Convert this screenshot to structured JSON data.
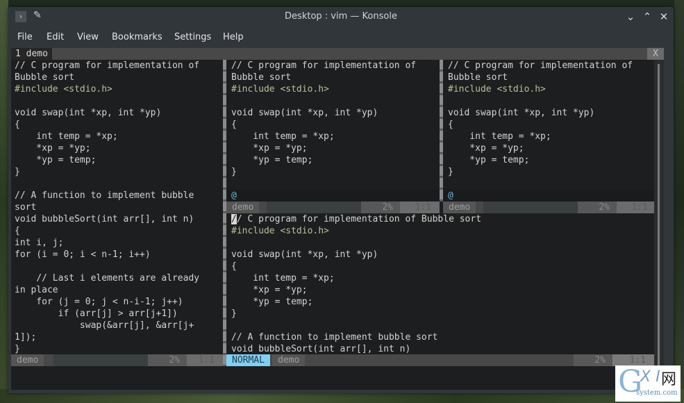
{
  "window": {
    "title": "Desktop : vim — Konsole",
    "app_icon": "terminal-icon",
    "controls": {
      "minimize": "⌄",
      "maximize": "⌃",
      "close": "✕"
    }
  },
  "menu": [
    "File",
    "Edit",
    "View",
    "Bookmarks",
    "Settings",
    "Help"
  ],
  "vim": {
    "tab": {
      "number": "1",
      "name": "demo",
      "close_label": "X"
    },
    "left_pane": {
      "lines": [
        "// C program for implementation of",
        "Bubble sort",
        "#include <stdio.h>",
        "",
        "void swap(int *xp, int *yp)",
        "{",
        "    int temp = *xp;",
        "    *xp = *yp;",
        "    *yp = temp;",
        "}",
        "",
        "// A function to implement bubble",
        "sort",
        "void bubbleSort(int arr[], int n)",
        "{",
        "int i, j;",
        "for (i = 0; i < n-1; i++)",
        "",
        "    // Last i elements are already",
        "in place",
        "    for (j = 0; j < n-i-1; j++)",
        "        if (arr[j] > arr[j+1])",
        "            swap(&arr[j], &arr[j+",
        "1]);",
        "}"
      ],
      "status": {
        "file": "demo",
        "percent": "2%",
        "position": "1:1"
      }
    },
    "top_middle_pane": {
      "lines": [
        "// C program for implementation of",
        "Bubble sort",
        "#include <stdio.h>",
        "",
        "void swap(int *xp, int *yp)",
        "{",
        "    int temp = *xp;",
        "    *xp = *yp;",
        "    *yp = temp;",
        "}",
        ""
      ],
      "filler": "@",
      "status": {
        "file": "demo",
        "percent": "2%",
        "position": "1:1"
      }
    },
    "top_right_pane": {
      "lines": [
        "// C program for implementation of",
        "Bubble sort",
        "#include <stdio.h>",
        "",
        "void swap(int *xp, int *yp)",
        "{",
        "    int temp = *xp;",
        "    *xp = *yp;",
        "    *yp = temp;",
        "}",
        ""
      ],
      "filler": "@",
      "status": {
        "file": "demo",
        "percent": "2%",
        "position": "1:1"
      }
    },
    "bottom_pane": {
      "cursor_char": "/",
      "first_line_rest": "/ C program for implementation of Bubble sort",
      "lines": [
        "#include <stdio.h>",
        "",
        "void swap(int *xp, int *yp)",
        "{",
        "    int temp = *xp;",
        "    *xp = *yp;",
        "    *yp = temp;",
        "}",
        "",
        "// A function to implement bubble sort",
        "void bubbleSort(int arr[], int n)"
      ],
      "status": {
        "mode": "NORMAL",
        "file": "demo",
        "percent": "2%",
        "position": "1:1"
      }
    }
  },
  "colors": {
    "normal_mode": "#7fd0f5",
    "include": "#b5c39a",
    "at_filler": "#6fb7d8"
  },
  "watermark": {
    "g": "G",
    "xi": "X I",
    "net": "网",
    "site": "system.com"
  }
}
